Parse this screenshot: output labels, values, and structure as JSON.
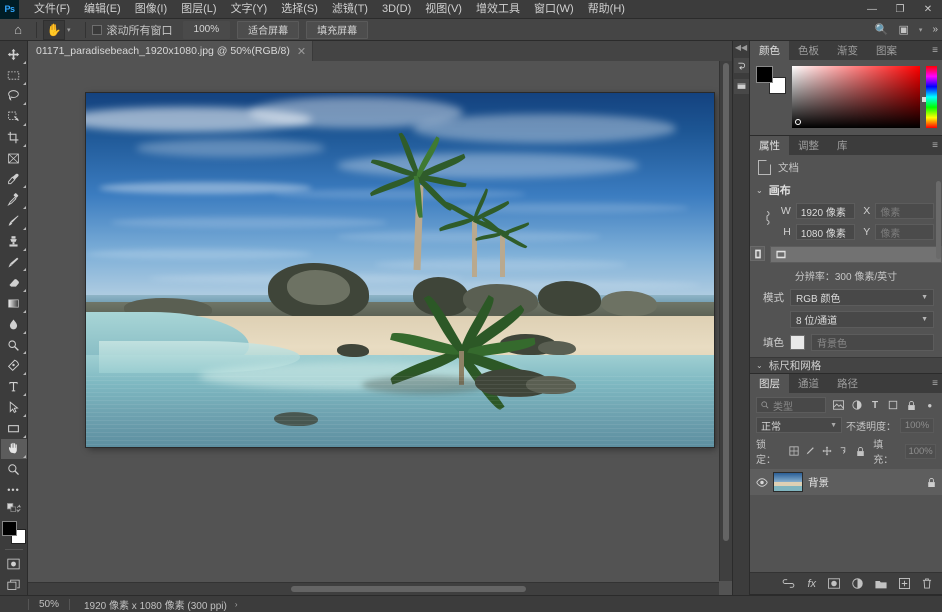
{
  "app": {
    "logo": "Ps"
  },
  "menubar": {
    "items": [
      {
        "label": "文件(F)"
      },
      {
        "label": "编辑(E)"
      },
      {
        "label": "图像(I)"
      },
      {
        "label": "图层(L)"
      },
      {
        "label": "文字(Y)"
      },
      {
        "label": "选择(S)"
      },
      {
        "label": "滤镜(T)"
      },
      {
        "label": "3D(D)"
      },
      {
        "label": "视图(V)"
      },
      {
        "label": "增效工具"
      },
      {
        "label": "窗口(W)"
      },
      {
        "label": "帮助(H)"
      }
    ],
    "window_controls": {
      "minimize": "—",
      "maximize": "❐",
      "close": "✕"
    }
  },
  "optionsbar": {
    "home_icon": "⌂",
    "tool_icon": "✋",
    "tool_caret": "▾",
    "scroll_all_windows": "滚动所有窗口",
    "zoom_100": "100%",
    "fit_screen": "适合屏幕",
    "fill_screen": "填充屏幕",
    "search_icon": "🔍",
    "workspace_icon": "▣",
    "workspace_caret": "▾",
    "overflow": "»"
  },
  "toolbar": {
    "tools": [
      {
        "name": "move-tool",
        "glyph": "✥",
        "active": false,
        "sub": true
      },
      {
        "name": "marquee-tool",
        "glyph": "▭",
        "active": false,
        "sub": true
      },
      {
        "name": "lasso-tool",
        "glyph": "◯",
        "active": false,
        "sub": true
      },
      {
        "name": "quick-selection-tool",
        "glyph": "❑",
        "active": false,
        "sub": true
      },
      {
        "name": "crop-tool",
        "glyph": "⌗",
        "active": false,
        "sub": true
      },
      {
        "name": "frame-tool",
        "glyph": "⊠",
        "active": false,
        "sub": false
      },
      {
        "name": "eyedropper-tool",
        "glyph": "✐",
        "active": false,
        "sub": true
      },
      {
        "name": "healing-brush-tool",
        "glyph": "✎",
        "active": false,
        "sub": true
      },
      {
        "name": "brush-tool",
        "glyph": "🖌",
        "active": false,
        "sub": true
      },
      {
        "name": "clone-stamp-tool",
        "glyph": "⊥",
        "active": false,
        "sub": true
      },
      {
        "name": "history-brush-tool",
        "glyph": "✒",
        "active": false,
        "sub": true
      },
      {
        "name": "eraser-tool",
        "glyph": "◣",
        "active": false,
        "sub": true
      },
      {
        "name": "gradient-tool",
        "glyph": "▤",
        "active": false,
        "sub": true
      },
      {
        "name": "blur-tool",
        "glyph": "💧",
        "active": false,
        "sub": true
      },
      {
        "name": "dodge-tool",
        "glyph": "◍",
        "active": false,
        "sub": true
      },
      {
        "name": "pen-tool",
        "glyph": "✒",
        "active": false,
        "sub": true
      },
      {
        "name": "type-tool",
        "glyph": "T",
        "active": false,
        "sub": true
      },
      {
        "name": "path-selection-tool",
        "glyph": "➤",
        "active": false,
        "sub": true
      },
      {
        "name": "rectangle-tool",
        "glyph": "▭",
        "active": false,
        "sub": true
      },
      {
        "name": "hand-tool",
        "glyph": "✋",
        "active": true,
        "sub": true
      },
      {
        "name": "zoom-tool",
        "glyph": "🔍",
        "active": false,
        "sub": false
      }
    ],
    "more_tools": "•••",
    "edit_toolbar_sub": true,
    "default_colors_icon": "◨",
    "swap_colors_icon": "⇄",
    "foreground_color": "#000000",
    "background_color": "#ffffff",
    "quick_mask_icon": "◙",
    "screen_mode_icon": "❐"
  },
  "document": {
    "tab_title": "01171_paradisebeach_1920x1080.jpg @ 50%(RGB/8)",
    "close_icon": "✕"
  },
  "right_rail": {
    "collapse_icon": "◀◀",
    "icons": [
      {
        "name": "history-panel-icon",
        "glyph": "↰"
      },
      {
        "name": "notes-panel-icon",
        "glyph": "▤"
      }
    ]
  },
  "color_panel": {
    "tabs": [
      {
        "label": "颜色",
        "active": true
      },
      {
        "label": "色板",
        "active": false
      },
      {
        "label": "渐变",
        "active": false
      },
      {
        "label": "图案",
        "active": false
      }
    ],
    "menu_icon": "≡",
    "foreground": "#000000",
    "background": "#ffffff"
  },
  "properties_panel": {
    "tabs": [
      {
        "label": "属性",
        "active": true
      },
      {
        "label": "调整",
        "active": false
      },
      {
        "label": "库",
        "active": false
      }
    ],
    "menu_icon": "≡",
    "header_label": "文档",
    "section_canvas": "画布",
    "width_label": "W",
    "width_value": "1920 像素",
    "x_label": "X",
    "x_placeholder": "像素",
    "height_label": "H",
    "height_value": "1080 像素",
    "y_label": "Y",
    "y_placeholder": "像素",
    "link_icon": "🔗",
    "orientation_portrait": "▯",
    "orientation_landscape": "▭",
    "resolution": "分辨率：300 像素/英寸",
    "mode_label": "模式",
    "mode_value": "RGB 颜色",
    "depth_value": "8 位/通道",
    "fill_label": "填色",
    "fill_swatch": "#e9e9e9",
    "fill_value": "背景色",
    "collapsed_section": "标尺和网格",
    "caret_down": "⌄",
    "caret_right": "›"
  },
  "layers_panel": {
    "tabs": [
      {
        "label": "图层",
        "active": true
      },
      {
        "label": "通道",
        "active": false
      },
      {
        "label": "路径",
        "active": false
      }
    ],
    "menu_icon": "≡",
    "filter_placeholder": "类型",
    "filter_icons": [
      {
        "name": "filter-pixel-icon",
        "glyph": "▣"
      },
      {
        "name": "filter-adjustment-icon",
        "glyph": "◑"
      },
      {
        "name": "filter-type-icon",
        "glyph": "T"
      },
      {
        "name": "filter-shape-icon",
        "glyph": "▢"
      },
      {
        "name": "filter-smart-object-icon",
        "glyph": "🔒"
      }
    ],
    "filter_toggle": "●",
    "blend_mode": "正常",
    "opacity_label": "不透明度：",
    "opacity_value": "100%",
    "lock_label": "锁定：",
    "lock_icons": [
      {
        "name": "lock-transparent-icon",
        "glyph": "▨"
      },
      {
        "name": "lock-image-icon",
        "glyph": "✎"
      },
      {
        "name": "lock-position-icon",
        "glyph": "✥"
      },
      {
        "name": "lock-nesting-icon",
        "glyph": "⇲"
      },
      {
        "name": "lock-all-icon",
        "glyph": "🔒"
      }
    ],
    "fill_label": "填充：",
    "fill_value": "100%",
    "layers": [
      {
        "name": "背景",
        "visible": true,
        "locked": true
      }
    ],
    "eye_icon": "👁",
    "lock_badge": "🔒",
    "footer_icons": [
      {
        "name": "link-layers-icon",
        "glyph": "⚭"
      },
      {
        "name": "layer-style-icon",
        "glyph": "fx"
      },
      {
        "name": "layer-mask-icon",
        "glyph": "▣"
      },
      {
        "name": "adjustment-layer-icon",
        "glyph": "◐"
      },
      {
        "name": "new-group-icon",
        "glyph": "🗀"
      },
      {
        "name": "new-layer-icon",
        "glyph": "⊞"
      },
      {
        "name": "delete-layer-icon",
        "glyph": "🗑"
      }
    ]
  },
  "statusbar": {
    "zoom": "50%",
    "doc_info": "1920 像素 x 1080 像素 (300 ppi)",
    "arrow": "›"
  }
}
